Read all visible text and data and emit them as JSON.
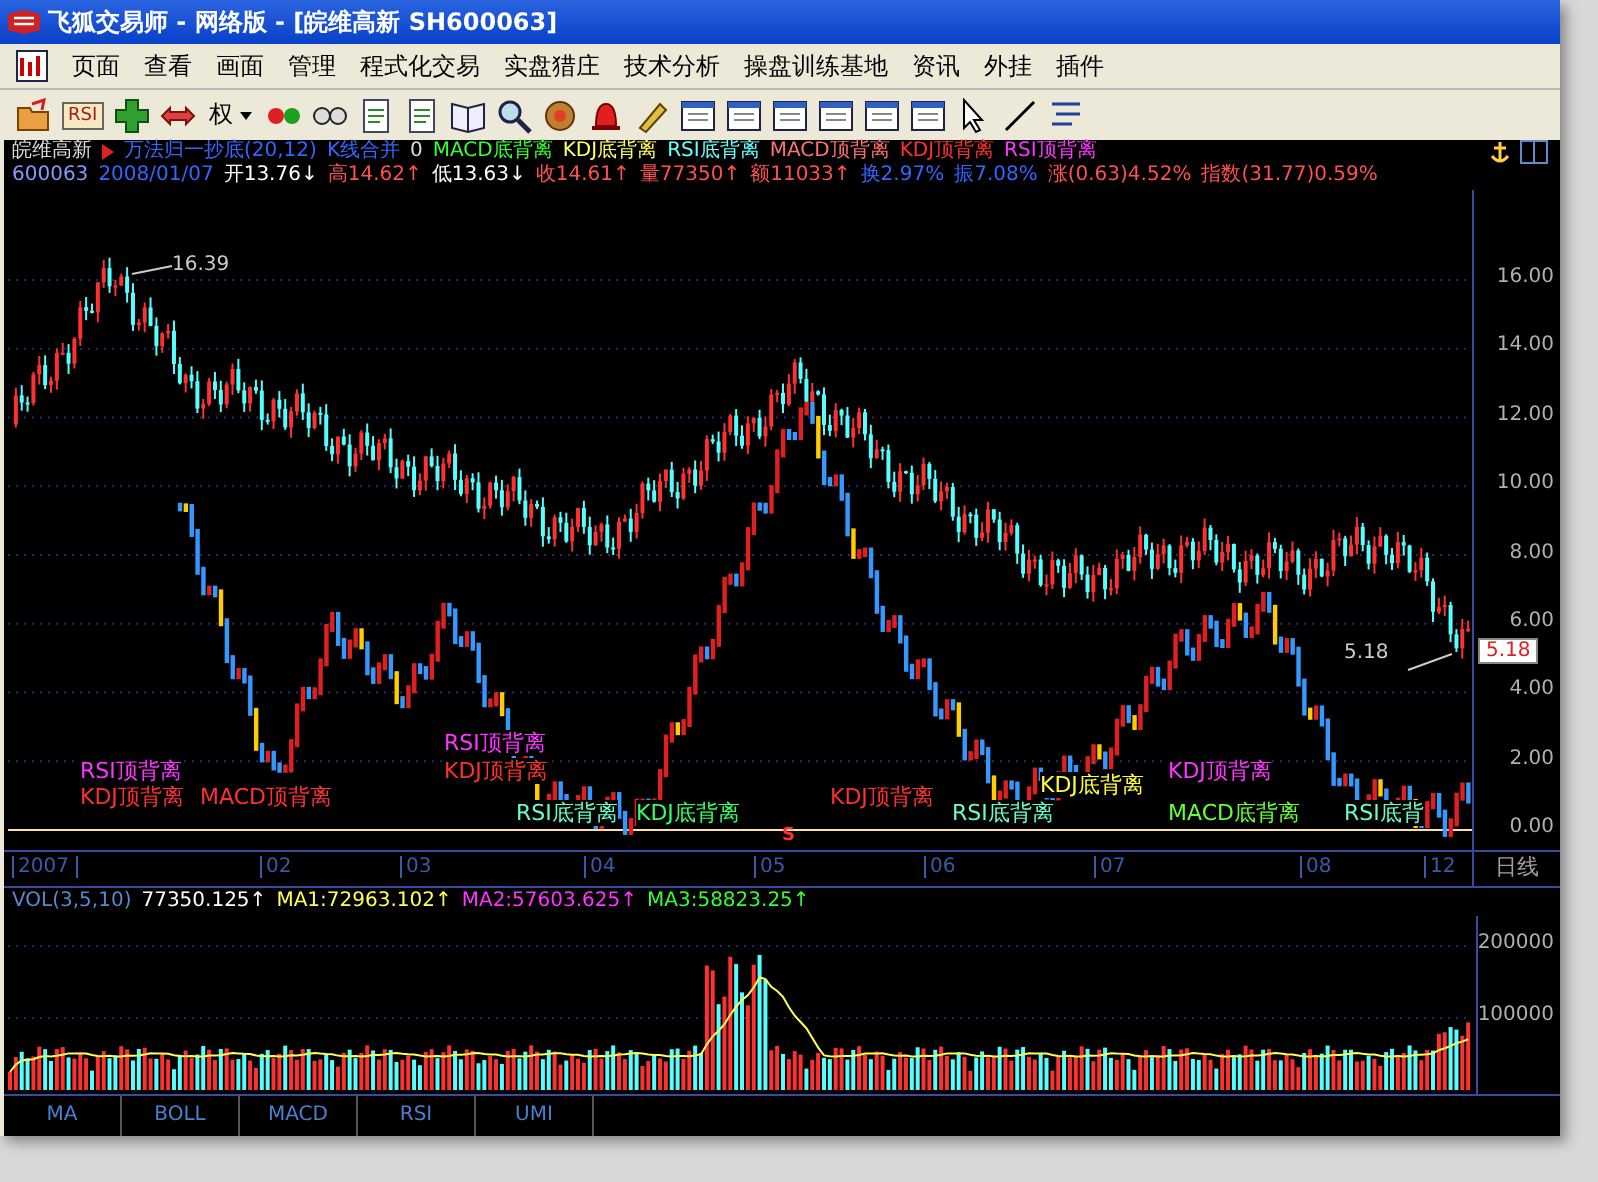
{
  "window": {
    "title": "飞狐交易师 - 网络版 - [皖维高新 SH600063]"
  },
  "menu": [
    "页面",
    "查看",
    "画面",
    "管理",
    "程式化交易",
    "实盘猎庄",
    "技术分析",
    "操盘训练基地",
    "资讯",
    "外挂",
    "插件"
  ],
  "toolbar": [
    {
      "kind": "open"
    },
    {
      "kind": "text",
      "label": "RSI"
    },
    {
      "kind": "plus"
    },
    {
      "kind": "arrows"
    },
    {
      "kind": "dropdown",
      "label": "权"
    },
    {
      "kind": "dots"
    },
    {
      "kind": "glasses"
    },
    {
      "kind": "doc"
    },
    {
      "kind": "doc"
    },
    {
      "kind": "book"
    },
    {
      "kind": "search"
    },
    {
      "kind": "coin"
    },
    {
      "kind": "bell"
    },
    {
      "kind": "pen"
    },
    {
      "kind": "panel"
    },
    {
      "kind": "panel"
    },
    {
      "kind": "panel"
    },
    {
      "kind": "panel"
    },
    {
      "kind": "panel"
    },
    {
      "kind": "panel"
    },
    {
      "kind": "cursor"
    },
    {
      "kind": "line"
    },
    {
      "kind": "lines"
    }
  ],
  "indicator_line": {
    "stock_name": "皖维高新",
    "formula": "万法归一抄底(20,12)",
    "merge_label": "K线合并",
    "merge_value": "0",
    "signals": [
      {
        "label": "MACD底背离",
        "color": "#33ff33"
      },
      {
        "label": "KDJ底背离",
        "color": "#ffff66"
      },
      {
        "label": "RSI底背离",
        "color": "#66ffff"
      },
      {
        "label": "MACD顶背离",
        "color": "#ff7070"
      },
      {
        "label": "KDJ顶背离",
        "color": "#ff3030"
      },
      {
        "label": "RSI顶背离",
        "color": "#ff33ff"
      }
    ]
  },
  "quote_line": [
    {
      "text": "600063",
      "color": "#8899ff"
    },
    {
      "text": "2008/01/07",
      "color": "#3366ff"
    },
    {
      "text": "开13.76↓",
      "color": "#ffffff"
    },
    {
      "text": "高14.62↑",
      "color": "#ff5050"
    },
    {
      "text": "低13.63↓",
      "color": "#ffffff"
    },
    {
      "text": "收14.61↑",
      "color": "#ff5050"
    },
    {
      "text": "量77350↑",
      "color": "#ff5050"
    },
    {
      "text": "额11033↑",
      "color": "#ff5050"
    },
    {
      "text": "换2.97%",
      "color": "#3366ff"
    },
    {
      "text": "振7.08%",
      "color": "#3366ff"
    },
    {
      "text": "涨(0.63)4.52%",
      "color": "#ff5050"
    },
    {
      "text": "指数(31.77)0.59%",
      "color": "#ff5050"
    }
  ],
  "price_axis": [
    "16.00",
    "14.00",
    "12.00",
    "10.00",
    "8.00",
    "6.00",
    "4.00",
    "2.00",
    "0.00"
  ],
  "price_badge": "5.18",
  "peak_label": "16.39",
  "last_label": "5.18",
  "sell_marker": "S",
  "chart_signals": [
    {
      "text": "RSI顶背离",
      "color": "#ff33ff"
    },
    {
      "text": "KDJ顶背离",
      "color": "#ff3030"
    },
    {
      "text": "MACD顶背离",
      "color": "#ff3030"
    },
    {
      "text": "RSI顶背离",
      "color": "#ff33ff"
    },
    {
      "text": "KDJ顶背离",
      "color": "#ff3030"
    },
    {
      "text": "RSI底背离",
      "color": "#66ffcc"
    },
    {
      "text": "KDJ底背离",
      "color": "#33ff66"
    },
    {
      "text": "KDJ顶背离",
      "color": "#ff3030"
    },
    {
      "text": "RSI底背离",
      "color": "#66ffcc"
    },
    {
      "text": "KDJ底背离",
      "color": "#ffff33"
    },
    {
      "text": "KDJ顶背离",
      "color": "#ff33ff"
    },
    {
      "text": "MACD底背离",
      "color": "#66ff33"
    },
    {
      "text": "RSI底背",
      "color": "#66ffcc"
    }
  ],
  "time_axis": {
    "labels": [
      "2007",
      "02",
      "03",
      "04",
      "05",
      "06",
      "07",
      "08",
      "12"
    ],
    "period": "日线"
  },
  "volume": {
    "legend": [
      {
        "text": "VOL(3,5,10)",
        "color": "#5588cc"
      },
      {
        "text": "77350.125↑",
        "color": "#ffffff"
      },
      {
        "text": "MA1:72963.102↑",
        "color": "#ffff55"
      },
      {
        "text": "MA2:57603.625↑",
        "color": "#ff33ff"
      },
      {
        "text": "MA3:58823.25↑",
        "color": "#33ff33"
      }
    ],
    "axis": [
      "200000",
      "100000"
    ]
  },
  "tabs": [
    {
      "label": "MA",
      "selected": false
    },
    {
      "label": "BOLL",
      "selected": false
    },
    {
      "label": "MACD",
      "selected": false
    },
    {
      "label": "RSI",
      "selected": false
    },
    {
      "label": "UMI",
      "selected": false
    }
  ]
}
